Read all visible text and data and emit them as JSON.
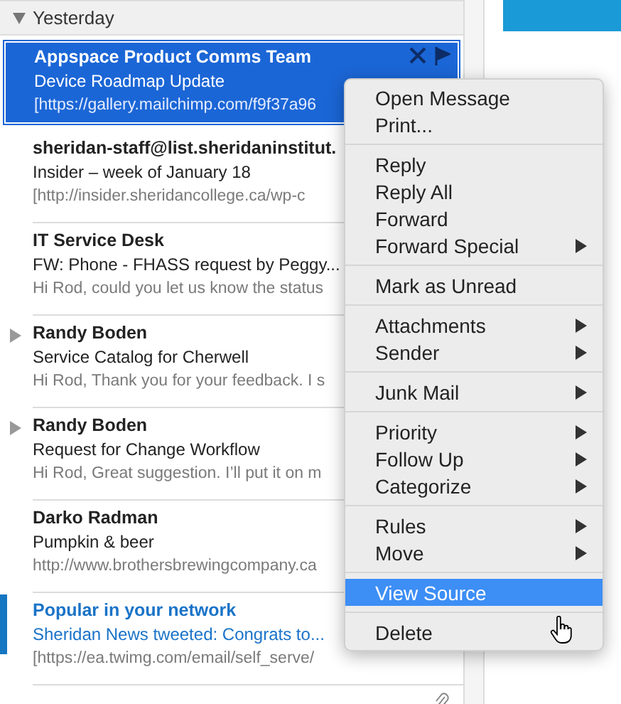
{
  "group": {
    "label": "Yesterday",
    "expanded": true
  },
  "messages": [
    {
      "sender": "Appspace Product Comms Team",
      "subject": "Device Roadmap Update",
      "preview": "[https://gallery.mailchimp.com/f9f37a96",
      "selected": true,
      "unread": false,
      "thread": false,
      "attachment": false
    },
    {
      "sender": "sheridan-staff@list.sheridaninstitut.",
      "subject": "Insider – week of January 18",
      "preview": "[http://insider.sheridancollege.ca/wp-c",
      "selected": false,
      "unread": false,
      "thread": false,
      "attachment": false
    },
    {
      "sender": "IT Service Desk",
      "subject": "FW: Phone - FHASS request by Peggy...",
      "preview": "Hi Rod, could you let us know the status",
      "selected": false,
      "unread": false,
      "thread": false,
      "attachment": false
    },
    {
      "sender": "Randy Boden",
      "subject": "Service Catalog for Cherwell",
      "preview": "Hi Rod, Thank you for your feedback. I s",
      "selected": false,
      "unread": false,
      "thread": true,
      "attachment": false
    },
    {
      "sender": "Randy Boden",
      "subject": "Request for Change Workflow",
      "preview": "Hi Rod, Great suggestion. I’ll put it on m",
      "selected": false,
      "unread": false,
      "thread": true,
      "attachment": false
    },
    {
      "sender": "Darko Radman",
      "subject": "Pumpkin & beer",
      "preview": "http://www.brothersbrewingcompany.ca",
      "selected": false,
      "unread": false,
      "thread": false,
      "attachment": false
    },
    {
      "sender": "Popular in your network",
      "subject": "Sheridan News tweeted: Congrats to...",
      "preview": "[https://ea.twimg.com/email/self_serve/",
      "selected": false,
      "unread": true,
      "thread": false,
      "attachment": false
    },
    {
      "selected": false,
      "unread": false,
      "thread": false,
      "attachment": true
    }
  ],
  "context_menu": {
    "groups": [
      [
        {
          "label": "Open Message",
          "submenu": false,
          "highlighted": false
        },
        {
          "label": "Print...",
          "submenu": false,
          "highlighted": false
        }
      ],
      [
        {
          "label": "Reply",
          "submenu": false,
          "highlighted": false
        },
        {
          "label": "Reply All",
          "submenu": false,
          "highlighted": false
        },
        {
          "label": "Forward",
          "submenu": false,
          "highlighted": false
        },
        {
          "label": "Forward Special",
          "submenu": true,
          "highlighted": false
        }
      ],
      [
        {
          "label": "Mark as Unread",
          "submenu": false,
          "highlighted": false
        }
      ],
      [
        {
          "label": "Attachments",
          "submenu": true,
          "highlighted": false
        },
        {
          "label": "Sender",
          "submenu": true,
          "highlighted": false
        }
      ],
      [
        {
          "label": "Junk Mail",
          "submenu": true,
          "highlighted": false
        }
      ],
      [
        {
          "label": "Priority",
          "submenu": true,
          "highlighted": false
        },
        {
          "label": "Follow Up",
          "submenu": true,
          "highlighted": false
        },
        {
          "label": "Categorize",
          "submenu": true,
          "highlighted": false
        }
      ],
      [
        {
          "label": "Rules",
          "submenu": true,
          "highlighted": false
        },
        {
          "label": "Move",
          "submenu": true,
          "highlighted": false
        }
      ],
      [
        {
          "label": "View Source",
          "submenu": false,
          "highlighted": true
        }
      ],
      [
        {
          "label": "Delete",
          "submenu": false,
          "highlighted": false
        }
      ]
    ]
  }
}
